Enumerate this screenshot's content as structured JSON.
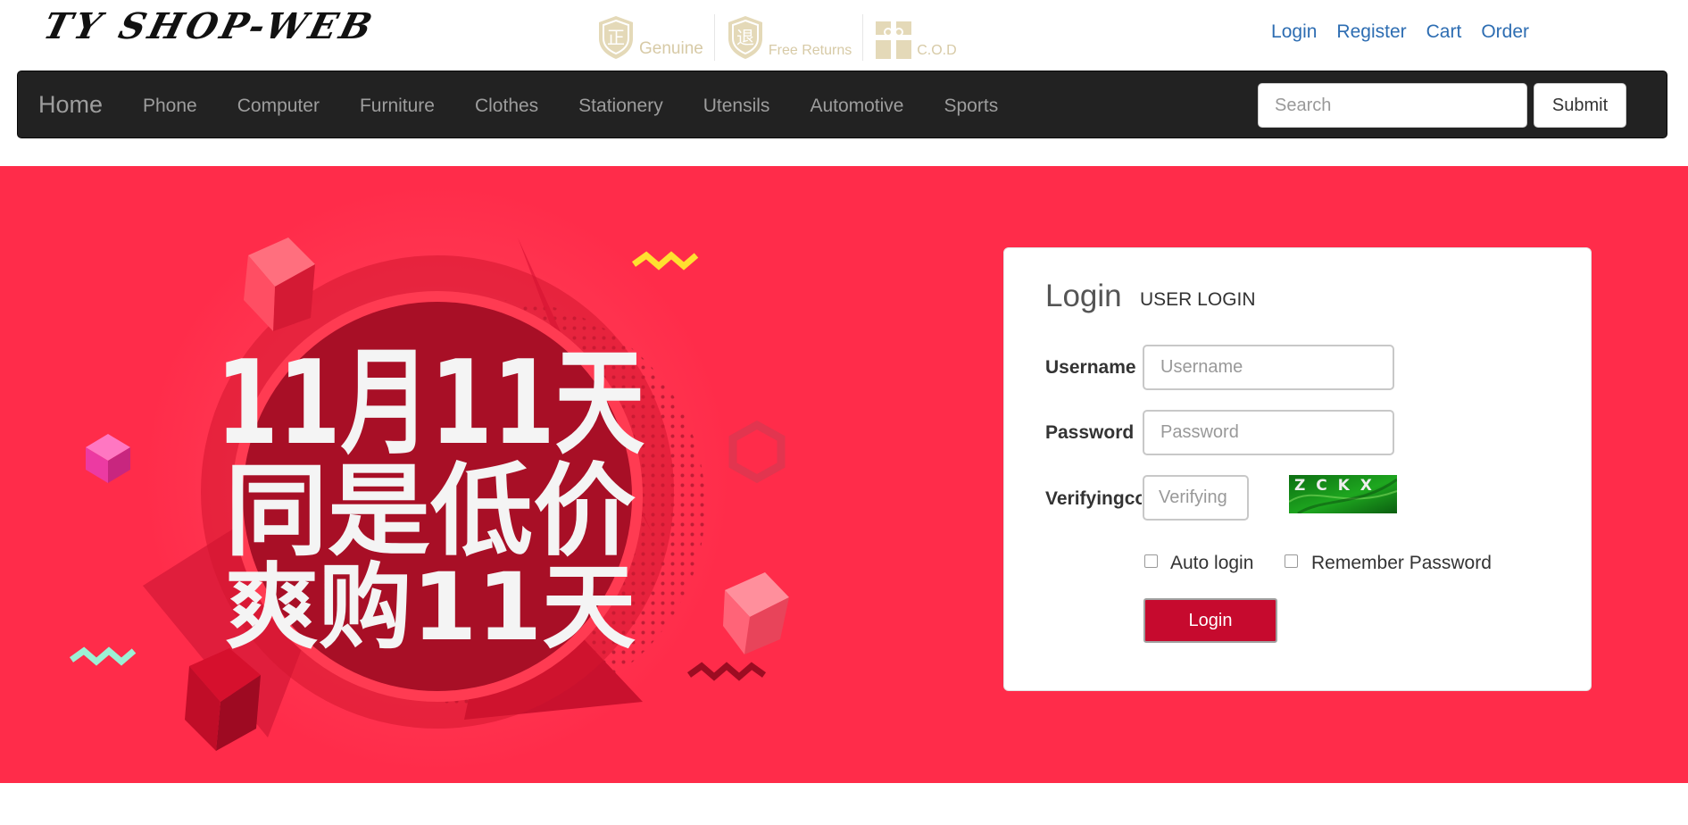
{
  "header": {
    "logo_text": "TY SHOP-WEB",
    "badges": [
      {
        "icon": "genuine-shield-icon",
        "glyph": "正",
        "label": "Genuine"
      },
      {
        "icon": "returns-shield-icon",
        "glyph": "退",
        "label": "Free Returns"
      },
      {
        "icon": "gift-icon",
        "label": "C.O.D"
      }
    ],
    "links": [
      "Login",
      "Register",
      "Cart",
      "Order"
    ]
  },
  "navbar": {
    "brand": "Home",
    "items": [
      "Phone",
      "Computer",
      "Furniture",
      "Clothes",
      "Stationery",
      "Utensils",
      "Automotive",
      "Sports"
    ],
    "search_placeholder": "Search",
    "submit_label": "Submit"
  },
  "banner": {
    "headline_lines": [
      "11月11天",
      "同是低价",
      "爽购11天"
    ],
    "background_color": "#ff2c4a"
  },
  "login": {
    "title": "Login",
    "subtitle": "USER LOGIN",
    "username_label": "Username",
    "username_placeholder": "Username",
    "password_label": "Password",
    "password_placeholder": "Password",
    "verify_label": "Verifyingcode",
    "verify_placeholder": "Verifying",
    "captcha_text": "Z C K X",
    "auto_login_label": "Auto login",
    "remember_label": "Remember Password",
    "button_label": "Login",
    "button_color": "#c60a2e"
  }
}
